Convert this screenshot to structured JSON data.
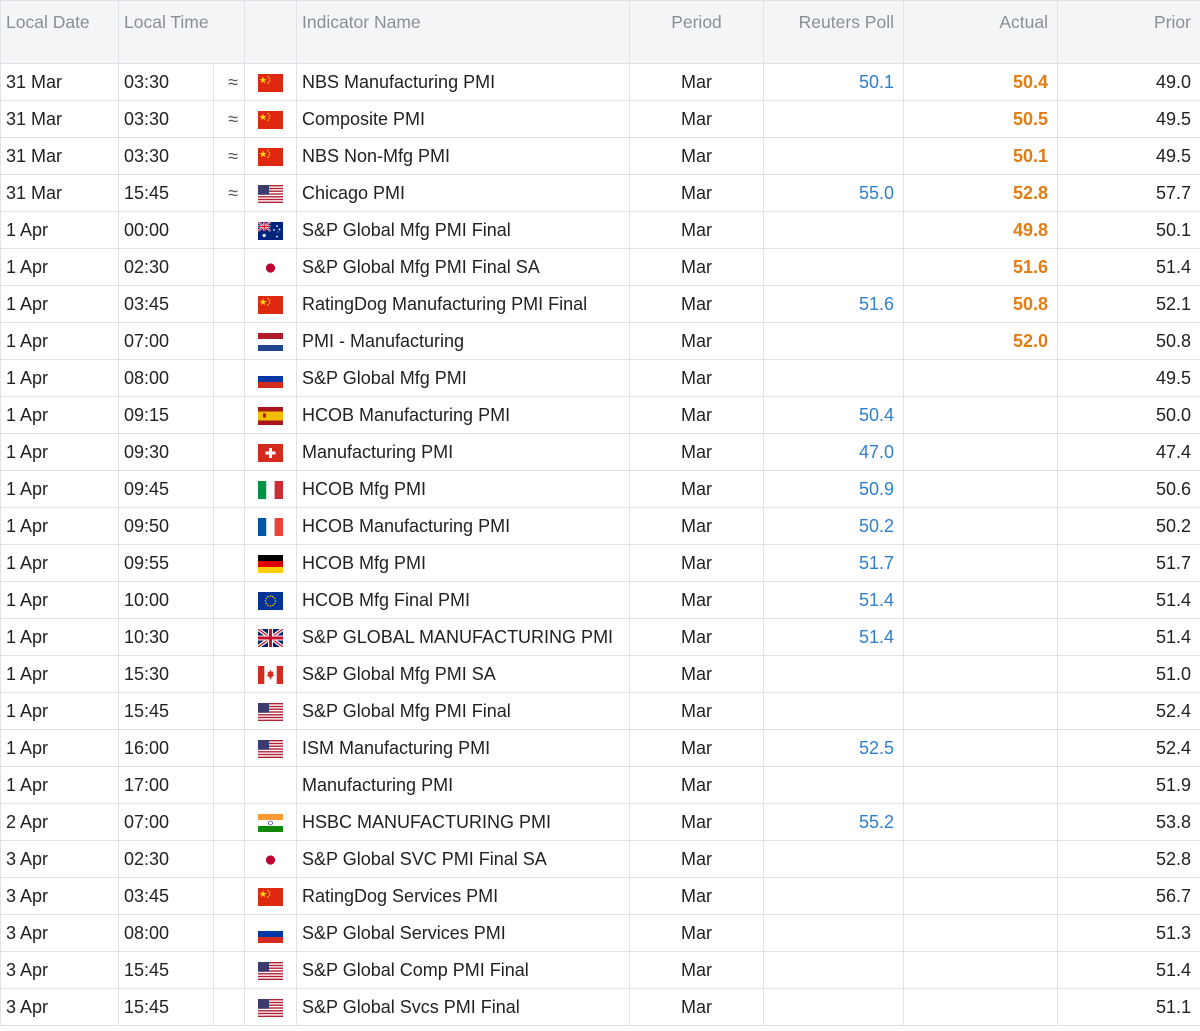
{
  "columns": {
    "local_date": "Local Date",
    "local_time": "Local Time",
    "indicator": "Indicator Name",
    "period": "Period",
    "poll": "Reuters Poll",
    "actual": "Actual",
    "prior": "Prior"
  },
  "approx_symbol": "≈",
  "rows": [
    {
      "date": "31 Mar",
      "time": "03:30",
      "approx": true,
      "flag": "china-flag-icon",
      "indicator": "NBS Manufacturing PMI",
      "period": "Mar",
      "poll": "50.1",
      "actual": "50.4",
      "prior": "49.0"
    },
    {
      "date": "31 Mar",
      "time": "03:30",
      "approx": true,
      "flag": "china-flag-icon",
      "indicator": "Composite PMI",
      "period": "Mar",
      "poll": "",
      "actual": "50.5",
      "prior": "49.5"
    },
    {
      "date": "31 Mar",
      "time": "03:30",
      "approx": true,
      "flag": "china-flag-icon",
      "indicator": "NBS Non-Mfg PMI",
      "period": "Mar",
      "poll": "",
      "actual": "50.1",
      "prior": "49.5"
    },
    {
      "date": "31 Mar",
      "time": "15:45",
      "approx": true,
      "flag": "usa-flag-icon",
      "indicator": "Chicago PMI",
      "period": "Mar",
      "poll": "55.0",
      "actual": "52.8",
      "prior": "57.7"
    },
    {
      "date": "1 Apr",
      "time": "00:00",
      "approx": false,
      "flag": "australia-flag-icon",
      "indicator": "S&P Global Mfg PMI Final",
      "period": "Mar",
      "poll": "",
      "actual": "49.8",
      "prior": "50.1"
    },
    {
      "date": "1 Apr",
      "time": "02:30",
      "approx": false,
      "flag": "japan-flag-icon",
      "indicator": "S&P Global Mfg PMI Final SA",
      "period": "Mar",
      "poll": "",
      "actual": "51.6",
      "prior": "51.4"
    },
    {
      "date": "1 Apr",
      "time": "03:45",
      "approx": false,
      "flag": "china-flag-icon",
      "indicator": "RatingDog Manufacturing PMI Final",
      "period": "Mar",
      "poll": "51.6",
      "actual": "50.8",
      "prior": "52.1"
    },
    {
      "date": "1 Apr",
      "time": "07:00",
      "approx": false,
      "flag": "netherlands-flag-icon",
      "indicator": "PMI - Manufacturing",
      "period": "Mar",
      "poll": "",
      "actual": "52.0",
      "prior": "50.8"
    },
    {
      "date": "1 Apr",
      "time": "08:00",
      "approx": false,
      "flag": "russia-flag-icon",
      "indicator": "S&P Global Mfg PMI",
      "period": "Mar",
      "poll": "",
      "actual": "",
      "prior": "49.5"
    },
    {
      "date": "1 Apr",
      "time": "09:15",
      "approx": false,
      "flag": "spain-flag-icon",
      "indicator": "HCOB Manufacturing PMI",
      "period": "Mar",
      "poll": "50.4",
      "actual": "",
      "prior": "50.0"
    },
    {
      "date": "1 Apr",
      "time": "09:30",
      "approx": false,
      "flag": "switzerland-flag-icon",
      "indicator": "Manufacturing PMI",
      "period": "Mar",
      "poll": "47.0",
      "actual": "",
      "prior": "47.4"
    },
    {
      "date": "1 Apr",
      "time": "09:45",
      "approx": false,
      "flag": "italy-flag-icon",
      "indicator": "HCOB Mfg PMI",
      "period": "Mar",
      "poll": "50.9",
      "actual": "",
      "prior": "50.6"
    },
    {
      "date": "1 Apr",
      "time": "09:50",
      "approx": false,
      "flag": "france-flag-icon",
      "indicator": "HCOB Manufacturing PMI",
      "period": "Mar",
      "poll": "50.2",
      "actual": "",
      "prior": "50.2"
    },
    {
      "date": "1 Apr",
      "time": "09:55",
      "approx": false,
      "flag": "germany-flag-icon",
      "indicator": "HCOB Mfg PMI",
      "period": "Mar",
      "poll": "51.7",
      "actual": "",
      "prior": "51.7"
    },
    {
      "date": "1 Apr",
      "time": "10:00",
      "approx": false,
      "flag": "eu-flag-icon",
      "indicator": "HCOB Mfg Final PMI",
      "period": "Mar",
      "poll": "51.4",
      "actual": "",
      "prior": "51.4"
    },
    {
      "date": "1 Apr",
      "time": "10:30",
      "approx": false,
      "flag": "uk-flag-icon",
      "indicator": "S&P GLOBAL MANUFACTURING PMI",
      "period": "Mar",
      "poll": "51.4",
      "actual": "",
      "prior": "51.4"
    },
    {
      "date": "1 Apr",
      "time": "15:30",
      "approx": false,
      "flag": "canada-flag-icon",
      "indicator": "S&P Global Mfg PMI SA",
      "period": "Mar",
      "poll": "",
      "actual": "",
      "prior": "51.0"
    },
    {
      "date": "1 Apr",
      "time": "15:45",
      "approx": false,
      "flag": "usa-flag-icon",
      "indicator": "S&P Global Mfg PMI Final",
      "period": "Mar",
      "poll": "",
      "actual": "",
      "prior": "52.4"
    },
    {
      "date": "1 Apr",
      "time": "16:00",
      "approx": false,
      "flag": "usa-flag-icon",
      "indicator": "ISM Manufacturing PMI",
      "period": "Mar",
      "poll": "52.5",
      "actual": "",
      "prior": "52.4"
    },
    {
      "date": "1 Apr",
      "time": "17:00",
      "approx": false,
      "flag": "",
      "indicator": "Manufacturing PMI",
      "period": "Mar",
      "poll": "",
      "actual": "",
      "prior": "51.9"
    },
    {
      "date": "2 Apr",
      "time": "07:00",
      "approx": false,
      "flag": "india-flag-icon",
      "indicator": "HSBC MANUFACTURING PMI",
      "period": "Mar",
      "poll": "55.2",
      "actual": "",
      "prior": "53.8"
    },
    {
      "date": "3 Apr",
      "time": "02:30",
      "approx": false,
      "flag": "japan-flag-icon",
      "indicator": "S&P Global SVC PMI Final SA",
      "period": "Mar",
      "poll": "",
      "actual": "",
      "prior": "52.8"
    },
    {
      "date": "3 Apr",
      "time": "03:45",
      "approx": false,
      "flag": "china-flag-icon",
      "indicator": "RatingDog Services PMI",
      "period": "Mar",
      "poll": "",
      "actual": "",
      "prior": "56.7"
    },
    {
      "date": "3 Apr",
      "time": "08:00",
      "approx": false,
      "flag": "russia-flag-icon",
      "indicator": "S&P Global Services PMI",
      "period": "Mar",
      "poll": "",
      "actual": "",
      "prior": "51.3"
    },
    {
      "date": "3 Apr",
      "time": "15:45",
      "approx": false,
      "flag": "usa-flag-icon",
      "indicator": "S&P Global Comp PMI Final",
      "period": "Mar",
      "poll": "",
      "actual": "",
      "prior": "51.4"
    },
    {
      "date": "3 Apr",
      "time": "15:45",
      "approx": false,
      "flag": "usa-flag-icon",
      "indicator": "S&P Global Svcs PMI Final",
      "period": "Mar",
      "poll": "",
      "actual": "",
      "prior": "51.1"
    }
  ],
  "colors": {
    "poll": "#2f7fcf",
    "actual": "#e07d14",
    "header_bg": "#f4f5f7",
    "grid": "#dfe3e8"
  }
}
